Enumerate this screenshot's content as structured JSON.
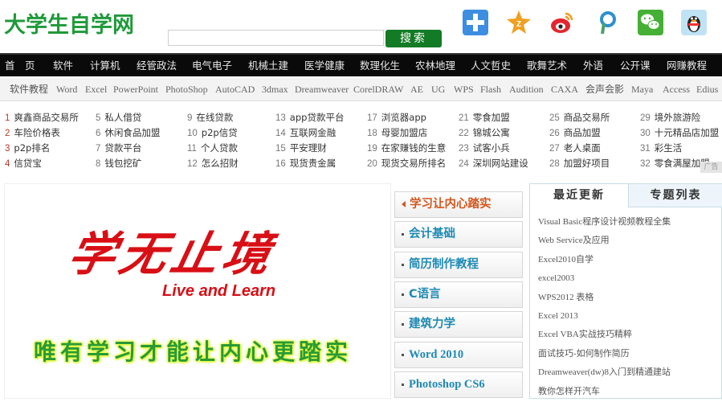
{
  "header": {
    "logo": "大学生自学网",
    "search": {
      "value": "",
      "placeholder": "",
      "button_label": "搜索"
    },
    "social_icons": [
      "plus-share-icon",
      "qzone-icon",
      "weibo-icon",
      "pinterest-icon",
      "wechat-icon",
      "qq-icon"
    ]
  },
  "main_nav": [
    "首　页",
    "软件",
    "计算机",
    "经管政法",
    "电气电子",
    "机械土建",
    "医学健康",
    "数理化生",
    "农林地理",
    "人文哲史",
    "歌舞艺术",
    "外语",
    "公开课",
    "网赚教程"
  ],
  "sub_nav": [
    "软件教程",
    "Word",
    "Excel",
    "PowerPoint",
    "PhotoShop",
    "AutoCAD",
    "3dmax",
    "Dreamweaver",
    "CorelDRAW",
    "AE",
    "UG",
    "WPS",
    "Flash",
    "Audition",
    "CAXA",
    "会声会影",
    "Maya",
    "Access",
    "Edius"
  ],
  "hot_links": [
    {
      "num": "1",
      "text": "爽鑫商品交易所"
    },
    {
      "num": "2",
      "text": "车险价格表"
    },
    {
      "num": "3",
      "text": "p2p排名"
    },
    {
      "num": "4",
      "text": "信贷宝"
    },
    {
      "num": "5",
      "text": "私人借贷"
    },
    {
      "num": "6",
      "text": "休闲食品加盟"
    },
    {
      "num": "7",
      "text": "贷款平台"
    },
    {
      "num": "8",
      "text": "钱包挖矿"
    },
    {
      "num": "9",
      "text": "在线贷款"
    },
    {
      "num": "10",
      "text": "p2p信贷"
    },
    {
      "num": "11",
      "text": "个人贷款"
    },
    {
      "num": "12",
      "text": "怎么招财"
    },
    {
      "num": "13",
      "text": "app贷款平台"
    },
    {
      "num": "14",
      "text": "互联网金融"
    },
    {
      "num": "15",
      "text": "平安理财"
    },
    {
      "num": "16",
      "text": "现货贵金属"
    },
    {
      "num": "17",
      "text": "浏览器app"
    },
    {
      "num": "18",
      "text": "母婴加盟店"
    },
    {
      "num": "19",
      "text": "在家赚钱的生意"
    },
    {
      "num": "20",
      "text": "现货交易所排名"
    },
    {
      "num": "21",
      "text": "零食加盟"
    },
    {
      "num": "22",
      "text": "锦城公寓"
    },
    {
      "num": "23",
      "text": "试客小兵"
    },
    {
      "num": "24",
      "text": "深圳网站建设"
    },
    {
      "num": "25",
      "text": "商品交易所"
    },
    {
      "num": "26",
      "text": "商品加盟"
    },
    {
      "num": "27",
      "text": "老人桌面"
    },
    {
      "num": "28",
      "text": "加盟好项目"
    },
    {
      "num": "29",
      "text": "境外旅游险"
    },
    {
      "num": "30",
      "text": "十元精品店加盟"
    },
    {
      "num": "31",
      "text": "彩生活"
    },
    {
      "num": "32",
      "text": "零食满屋加盟"
    }
  ],
  "ad_label": "广告",
  "banner": {
    "title": "学无止境",
    "subtitle": "Live and Learn",
    "slogan": "唯有学习才能让内心更踏实"
  },
  "mid_menu": [
    {
      "label": "学习让内心踏实",
      "active": true
    },
    {
      "label": "会计基础",
      "active": false
    },
    {
      "label": "简历制作教程",
      "active": false
    },
    {
      "label": "C语言",
      "active": false
    },
    {
      "label": "建筑力学",
      "active": false
    },
    {
      "label": "Word 2010",
      "active": false
    },
    {
      "label": "Photoshop CS6",
      "active": false
    }
  ],
  "right_panel": {
    "tabs": [
      "最近更新",
      "专题列表"
    ],
    "active_tab": "最近更新",
    "items": [
      "Visual Basic程序设计视频教程全集",
      "Web Service及应用",
      "Excel2010自学",
      "excel2003",
      "WPS2012 表格",
      "Excel 2013",
      "Excel VBA实战技巧精粹",
      "面试技巧-如何制作简历",
      "Dreamweaver(dw)8入门到精通建站",
      "教你怎样开汽车"
    ]
  },
  "colors": {
    "brand_green": "#1f9a3a",
    "search_button": "#137a25",
    "nav_bg": "#0a0a0a",
    "banner_red": "#d80f15",
    "menu_blue": "#1e8ab4",
    "menu_active": "#d3561d"
  }
}
